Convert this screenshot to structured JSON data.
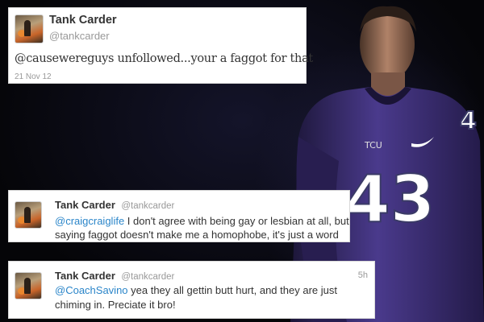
{
  "tweets": [
    {
      "name": "Tank Carder",
      "handle": "@tankcarder",
      "text": "@causewereguys unfollowed...your a faggot for that",
      "date": "21 Nov 12"
    },
    {
      "name": "Tank Carder",
      "handle": "@tankcarder",
      "mention": "@craigcraiglife",
      "text": " I don't agree with being gay or lesbian at all, but saying faggot doesn't make me a homophobe, it's just a word"
    },
    {
      "name": "Tank Carder",
      "handle": "@tankcarder",
      "time": "5h",
      "mention": "@CoachSavino",
      "text": " yea they all gettin butt hurt, and they are just chiming in. Preciate it bro!"
    }
  ],
  "photo": {
    "jersey_number": "43",
    "colors": {
      "jersey": "#3e2d7a",
      "background": "#05050a"
    }
  }
}
